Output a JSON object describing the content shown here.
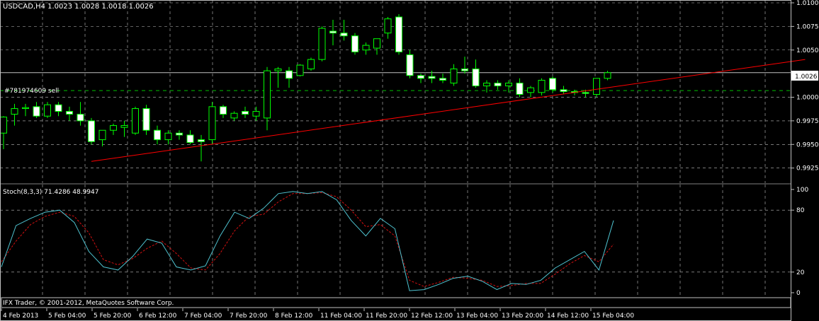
{
  "colors": {
    "background": "#000000",
    "grid": "#c0c0c0",
    "frame": "#c0c0c0",
    "text": "#ffffff",
    "bull_candle": "#00ff00",
    "bear_body": "#ffffff",
    "trendline": "#ff0000",
    "order_line": "#00c000",
    "bid_line": "#c0c0c0",
    "stoch_main": "#4fc3d0",
    "stoch_signal": "#d01010"
  },
  "main_header": "USDCAD,H4  1.0023 1.0028 1.0018 1.0026",
  "order_label": "#781974609 sell",
  "current_price_label": "1.0026",
  "price_ticks": [
    "1.0100",
    "1.0075",
    "1.0050",
    "1.0000",
    "0.9975",
    "0.9950",
    "0.9925"
  ],
  "stoch_header": "Stoch(8,3,3) 71.4286 48.9947",
  "stoch_ticks": [
    "100",
    "80",
    "20",
    "0"
  ],
  "copyright": "IFX Trader, © 2001-2012, MetaQuotes Software Corp.",
  "date_labels": [
    "4 Feb 2013",
    "5 Feb 04:00",
    "5 Feb 20:00",
    "6 Feb 12:00",
    "7 Feb 04:00",
    "7 Feb 20:00",
    "8 Feb 12:00",
    "11 Feb 04:00",
    "11 Feb 20:00",
    "12 Feb 12:00",
    "13 Feb 04:00",
    "13 Feb 20:00",
    "14 Feb 12:00",
    "15 Feb 04:00"
  ],
  "chart_data": [
    {
      "type": "candlestick",
      "title": "USDCAD,H4",
      "price_ylim": [
        0.9915,
        1.01
      ],
      "order_price": 1.0007,
      "current_price": 1.0026,
      "trendline": {
        "start": [
          8,
          0.9932
        ],
        "end": [
          73,
          1.004
        ]
      },
      "candles": [
        [
          0.9962,
          0.998,
          0.9945,
          0.9979
        ],
        [
          0.9982,
          0.9993,
          0.997,
          0.9988
        ],
        [
          0.9988,
          0.9993,
          0.998,
          0.9989
        ],
        [
          0.999,
          0.9995,
          0.9978,
          0.998
        ],
        [
          0.998,
          0.9995,
          0.9978,
          0.9992
        ],
        [
          0.9992,
          0.9995,
          0.998,
          0.9985
        ],
        [
          0.9985,
          0.999,
          0.9975,
          0.9982
        ],
        [
          0.9982,
          0.9995,
          0.997,
          0.9975
        ],
        [
          0.9975,
          0.9978,
          0.995,
          0.9953
        ],
        [
          0.9955,
          0.9965,
          0.9948,
          0.9965
        ],
        [
          0.9965,
          0.9972,
          0.996,
          0.997
        ],
        [
          0.9968,
          0.9975,
          0.9958,
          0.997
        ],
        [
          0.9962,
          0.999,
          0.996,
          0.9988
        ],
        [
          0.9988,
          0.9992,
          0.996,
          0.9965
        ],
        [
          0.9965,
          0.997,
          0.995,
          0.9955
        ],
        [
          0.9955,
          0.9965,
          0.995,
          0.9962
        ],
        [
          0.9962,
          0.9965,
          0.9955,
          0.996
        ],
        [
          0.996,
          0.9965,
          0.995,
          0.9952
        ],
        [
          0.9955,
          0.996,
          0.9932,
          0.9953
        ],
        [
          0.9955,
          0.9995,
          0.995,
          0.999
        ],
        [
          0.999,
          0.9992,
          0.9978,
          0.9982
        ],
        [
          0.9978,
          0.9985,
          0.9975,
          0.9983
        ],
        [
          0.9985,
          0.999,
          0.9978,
          0.9982
        ],
        [
          0.998,
          0.999,
          0.9975,
          0.9985
        ],
        [
          0.9978,
          1.0032,
          0.9965,
          1.0028
        ],
        [
          1.0028,
          1.0032,
          1.001,
          1.003
        ],
        [
          1.0028,
          1.0032,
          1.001,
          1.002
        ],
        [
          1.0023,
          1.0035,
          1.0022,
          1.0034
        ],
        [
          1.003,
          1.0042,
          1.0028,
          1.004
        ],
        [
          1.004,
          1.0075,
          1.0038,
          1.0073
        ],
        [
          1.007,
          1.0082,
          1.0055,
          1.0068
        ],
        [
          1.0068,
          1.0082,
          1.006,
          1.0065
        ],
        [
          1.0065,
          1.0068,
          1.0045,
          1.0048
        ],
        [
          1.005,
          1.0058,
          1.0045,
          1.0055
        ],
        [
          1.0052,
          1.0062,
          1.0045,
          1.0062
        ],
        [
          1.0068,
          1.0085,
          1.0062,
          1.0083
        ],
        [
          1.0085,
          1.0088,
          1.0045,
          1.0048
        ],
        [
          1.0045,
          1.005,
          1.002,
          1.0023
        ],
        [
          1.0023,
          1.0025,
          1.0015,
          1.002
        ],
        [
          1.0022,
          1.0028,
          1.0015,
          1.002
        ],
        [
          1.002,
          1.0025,
          1.0015,
          1.0018
        ],
        [
          1.0015,
          1.0035,
          1.0012,
          1.003
        ],
        [
          1.003,
          1.0043,
          1.0025,
          1.0028
        ],
        [
          1.003,
          1.004,
          1.001,
          1.0012
        ],
        [
          1.0012,
          1.0018,
          1.0005,
          1.0015
        ],
        [
          1.0015,
          1.0018,
          1.0008,
          1.0012
        ],
        [
          1.0012,
          1.0018,
          1.0005,
          1.0015
        ],
        [
          1.0015,
          1.002,
          1.0,
          1.0003
        ],
        [
          1.0005,
          1.0012,
          1.0,
          1.001
        ],
        [
          1.0005,
          1.002,
          1.0002,
          1.0018
        ],
        [
          1.002,
          1.0022,
          1.0005,
          1.0008
        ],
        [
          1.0008,
          1.0012,
          1.0003,
          1.0006
        ],
        [
          1.0006,
          1.0008,
          1.0002,
          1.0005
        ],
        [
          1.0005,
          1.0008,
          1.0,
          1.0004
        ],
        [
          1.0003,
          1.002,
          1.0,
          1.002
        ],
        [
          1.002,
          1.0028,
          1.0018,
          1.0026
        ]
      ]
    },
    {
      "type": "line",
      "title": "Stoch(8,3,3)",
      "ylim": [
        0,
        100
      ],
      "levels": [
        20,
        80
      ],
      "series": [
        {
          "name": "main",
          "values": [
            25,
            65,
            72,
            78,
            80,
            68,
            40,
            25,
            22,
            35,
            52,
            48,
            25,
            22,
            26,
            55,
            78,
            72,
            82,
            96,
            98,
            96,
            98,
            90,
            70,
            55,
            72,
            62,
            2,
            3,
            8,
            14,
            16,
            11,
            3,
            9,
            8,
            12,
            24,
            32,
            40,
            22,
            70
          ]
        },
        {
          "name": "signal",
          "values": [
            30,
            50,
            66,
            74,
            78,
            74,
            58,
            32,
            27,
            33,
            43,
            50,
            38,
            24,
            22,
            38,
            60,
            74,
            76,
            88,
            96,
            96,
            97,
            93,
            80,
            64,
            66,
            55,
            12,
            6,
            10,
            15,
            14,
            12,
            6,
            7,
            9,
            9,
            18,
            28,
            36,
            30,
            47
          ]
        }
      ]
    }
  ]
}
